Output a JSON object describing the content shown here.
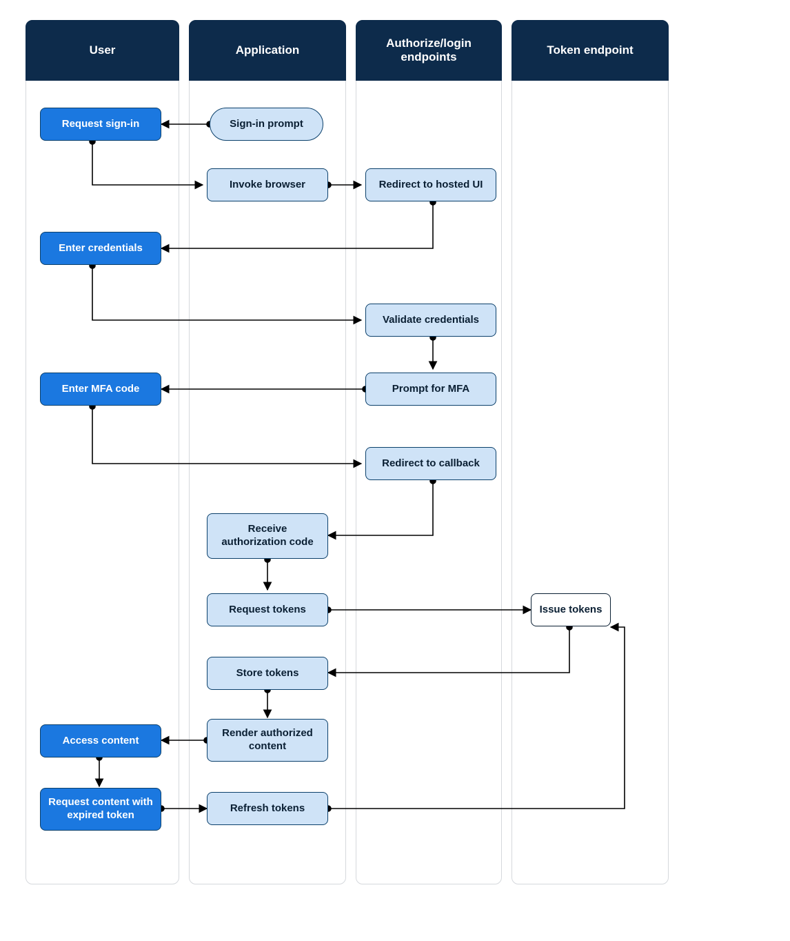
{
  "diagram": {
    "type": "swimlane-flow",
    "lanes": {
      "user": {
        "title": "User"
      },
      "app": {
        "title": "Application"
      },
      "authz": {
        "title": "Authorize/login endpoints"
      },
      "token": {
        "title": "Token endpoint"
      }
    },
    "nodes": {
      "signin_prompt": {
        "label": "Sign-in prompt"
      },
      "request_signin": {
        "label": "Request sign-in"
      },
      "invoke_browser": {
        "label": "Invoke browser"
      },
      "redirect_hosted": {
        "label": "Redirect to hosted UI"
      },
      "enter_creds": {
        "label": "Enter credentials"
      },
      "validate_creds": {
        "label": "Validate credentials"
      },
      "prompt_mfa": {
        "label": "Prompt for MFA"
      },
      "enter_mfa": {
        "label": "Enter MFA code"
      },
      "redirect_cb": {
        "label": "Redirect to callback"
      },
      "recv_authcode": {
        "label": "Receive authorization code"
      },
      "request_tokens": {
        "label": "Request tokens"
      },
      "issue_tokens": {
        "label": "Issue tokens"
      },
      "store_tokens": {
        "label": "Store tokens"
      },
      "render_content": {
        "label": "Render authorized content"
      },
      "access_content": {
        "label": "Access content"
      },
      "req_expired": {
        "label": "Request content with expired token"
      },
      "refresh_tokens": {
        "label": "Refresh tokens"
      }
    }
  }
}
